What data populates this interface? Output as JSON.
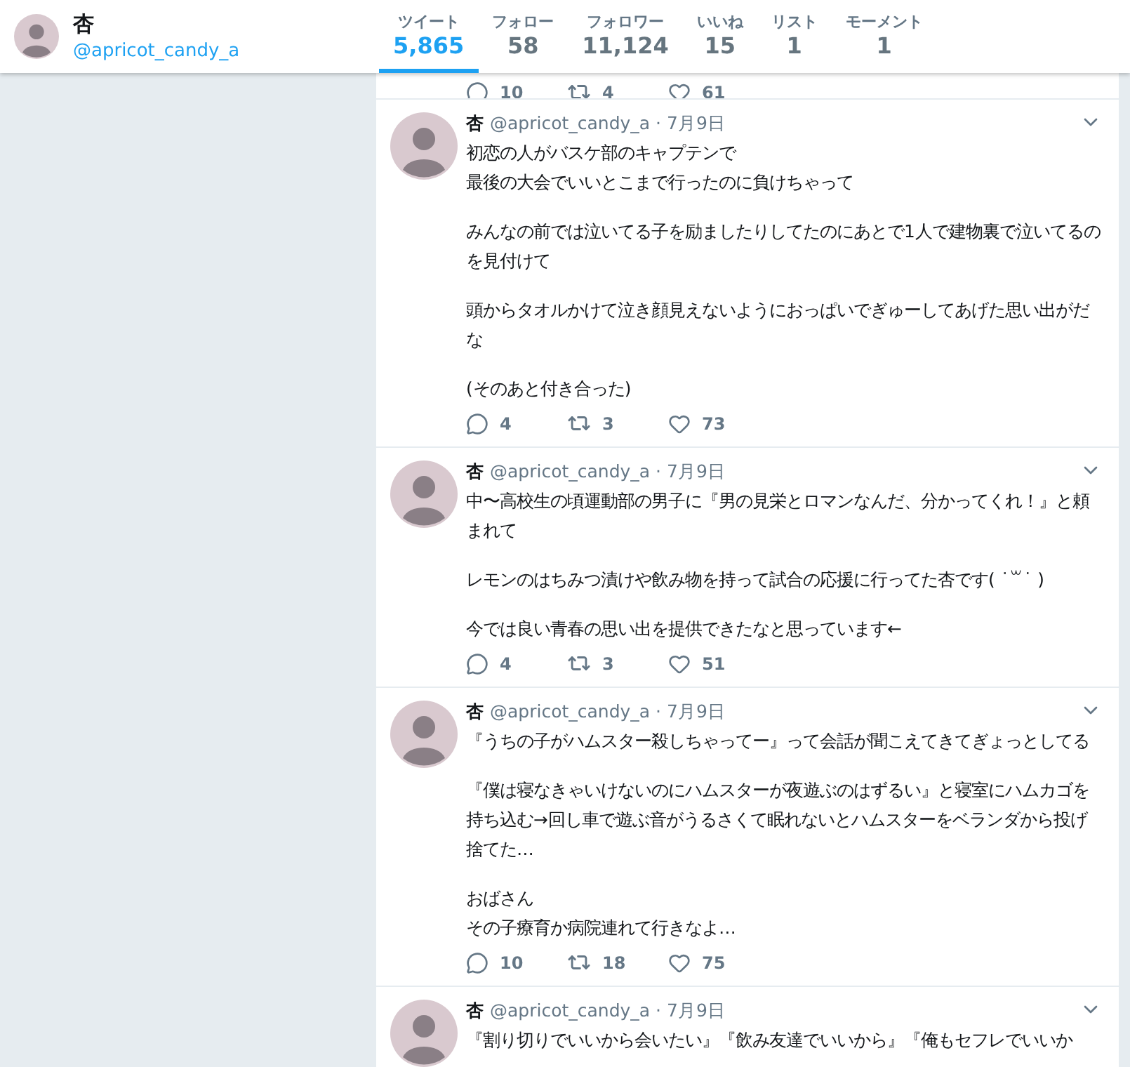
{
  "profile": {
    "name": "杏",
    "handle": "@apricot_candy_a"
  },
  "stats": [
    {
      "label": "ツイート",
      "value": "5,865",
      "selected": true
    },
    {
      "label": "フォロー",
      "value": "58",
      "selected": false
    },
    {
      "label": "フォロワー",
      "value": "11,124",
      "selected": false
    },
    {
      "label": "いいね",
      "value": "15",
      "selected": false
    },
    {
      "label": "リスト",
      "value": "1",
      "selected": false
    },
    {
      "label": "モーメント",
      "value": "1",
      "selected": false
    }
  ],
  "partial_actions": {
    "replies": "10",
    "retweets": "4",
    "likes": "61"
  },
  "tweets": [
    {
      "name": "杏",
      "meta": "@apricot_candy_a · 7月9日",
      "paragraphs": [
        [
          "初恋の人がバスケ部のキャプテンで",
          "最後の大会でいいとこまで行ったのに負けちゃって"
        ],
        [
          "みんなの前では泣いてる子を励ましたりしてたのにあとで1人で建物裏で泣いてるのを見付けて"
        ],
        [
          "頭からタオルかけて泣き顔見えないようにおっぱいでぎゅーしてあげた思い出がだな"
        ],
        [
          "(そのあと付き合った)"
        ]
      ],
      "replies": "4",
      "retweets": "3",
      "likes": "73"
    },
    {
      "name": "杏",
      "meta": "@apricot_candy_a · 7月9日",
      "paragraphs": [
        [
          "中〜高校生の頃運動部の男子に『男の見栄とロマンなんだ、分かってくれ！』と頼まれて"
        ],
        [
          "レモンのはちみつ漬けや飲み物を持って試合の応援に行ってた杏です( ˙꒳˙ )"
        ],
        [
          "今では良い青春の思い出を提供できたなと思っています←"
        ]
      ],
      "replies": "4",
      "retweets": "3",
      "likes": "51"
    },
    {
      "name": "杏",
      "meta": "@apricot_candy_a · 7月9日",
      "paragraphs": [
        [
          "『うちの子がハムスター殺しちゃってー』って会話が聞こえてきてぎょっとしてる"
        ],
        [
          "『僕は寝なきゃいけないのにハムスターが夜遊ぶのはずるい』と寝室にハムカゴを持ち込む→回し車で遊ぶ音がうるさくて眠れないとハムスターをベランダから投げ捨てた…"
        ],
        [
          "おばさん",
          "その子療育か病院連れて行きなよ…"
        ]
      ],
      "replies": "10",
      "retweets": "18",
      "likes": "75"
    },
    {
      "name": "杏",
      "meta": "@apricot_candy_a · 7月9日",
      "paragraphs": [
        [
          "『割り切りでいいから会いたい』『飲み友達でいいから』『俺もセフレでいいか"
        ]
      ]
    }
  ]
}
